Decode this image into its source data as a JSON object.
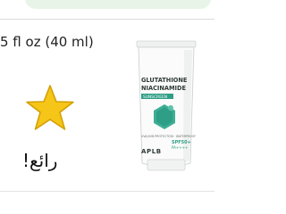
{
  "product": {
    "size": "5 fl oz (40 ml)",
    "image": {
      "brand": "APLB",
      "line1": "GLUTATHIONE",
      "line2": "NIACINAMIDE",
      "tag": "SUNSCREEN",
      "spf": "SPF50+",
      "pa": "PA++++",
      "small_text": "UVA/UVB PROTECTION · WATERPROOF",
      "accent_color": "#2f9e86"
    }
  },
  "rating": {
    "stars": 1,
    "star_color": "#f5c518",
    "label": "رائع!"
  }
}
